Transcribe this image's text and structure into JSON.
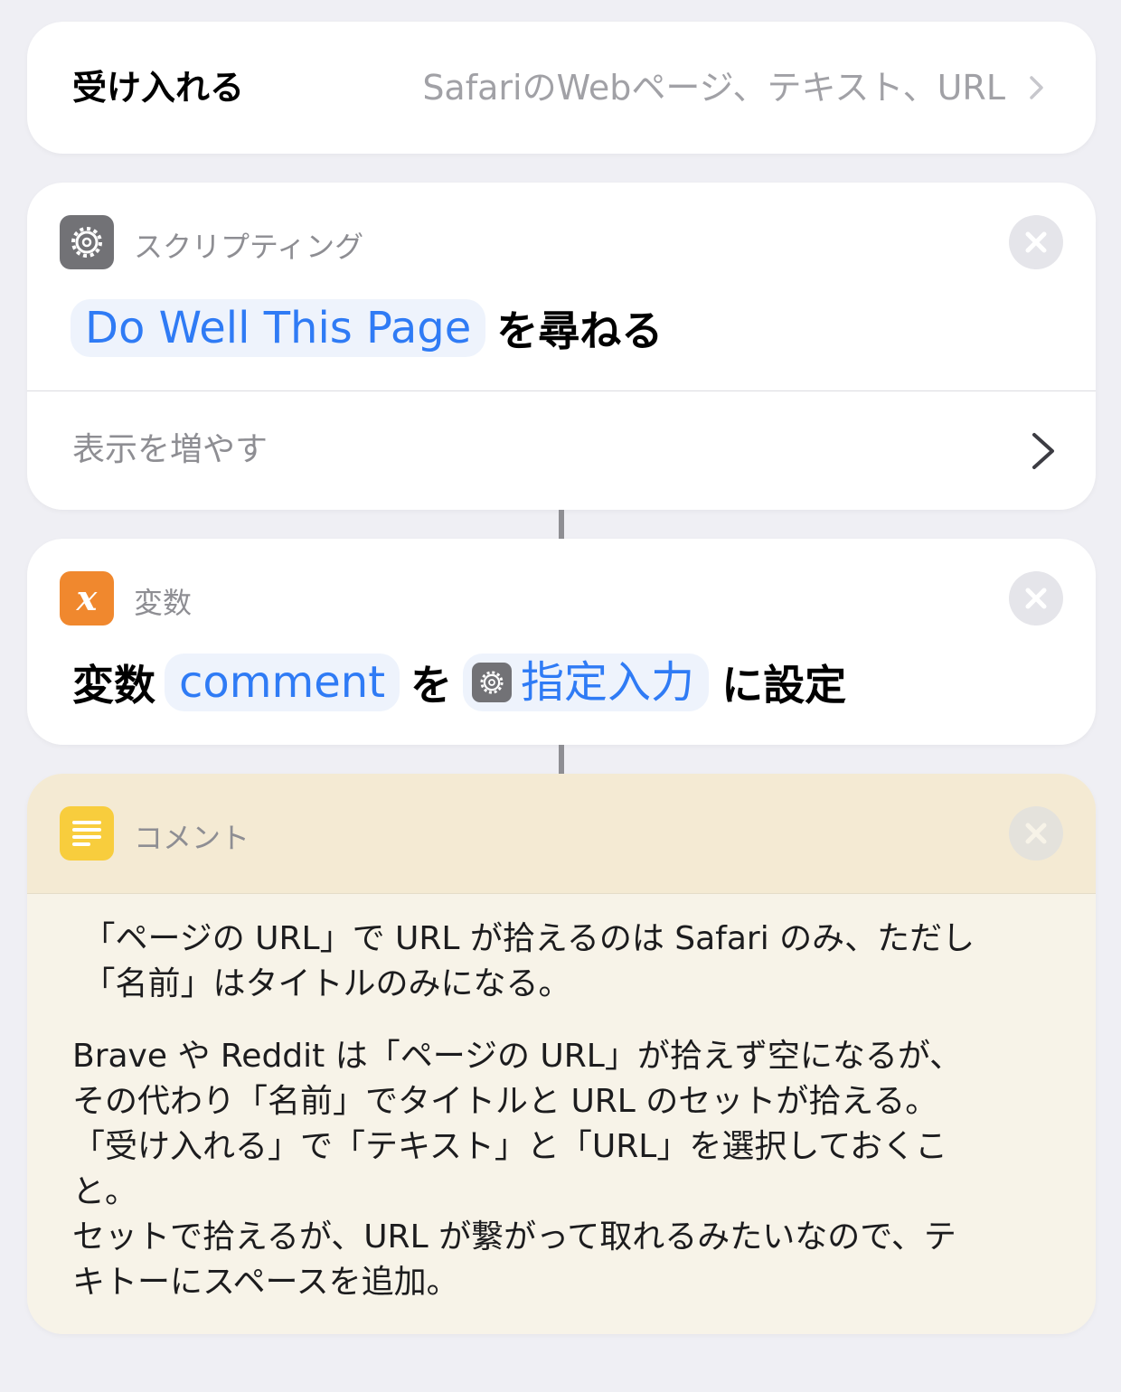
{
  "accepts": {
    "label": "受け入れる",
    "value": "SafariのWebページ、テキスト、URL"
  },
  "actions": {
    "scripting": {
      "category": "スクリプティング",
      "icon": "gear-icon",
      "question_token": "Do Well This Page",
      "question_suffix": "を尋ねる",
      "show_more": "表示を増やす"
    },
    "variable": {
      "category": "変数",
      "icon": "variable-x-icon",
      "prefix": "変数",
      "variable_name": "comment",
      "middle": "を",
      "input_token": "指定入力",
      "suffix": "に設定"
    },
    "comment": {
      "category": "コメント",
      "icon": "text-lines-icon",
      "paragraphs": [
        " 「ページの URL」で URL が拾えるのは Safari のみ、ただし\n 「名前」はタイトルのみになる。",
        "Brave や Reddit は「ページの URL」が拾えず空になるが、\nその代わり「名前」でタイトルと URL のセットが拾える。\n「受け入れる」で「テキスト」と「URL」を選択しておくこ\nと。\nセットで拾えるが、URL が繋がって取れるみたいなので、テ\nキトーにスペースを追加。"
      ]
    }
  },
  "colors": {
    "background": "#efeff4",
    "token_text": "#2f7bf5",
    "token_bg": "#eef3fc",
    "scripting_icon": "#727276",
    "variable_icon": "#f0882e",
    "comment_icon": "#f8cd3d",
    "comment_bg": "#f7f3e8",
    "comment_header_bg": "#f4ead3"
  }
}
